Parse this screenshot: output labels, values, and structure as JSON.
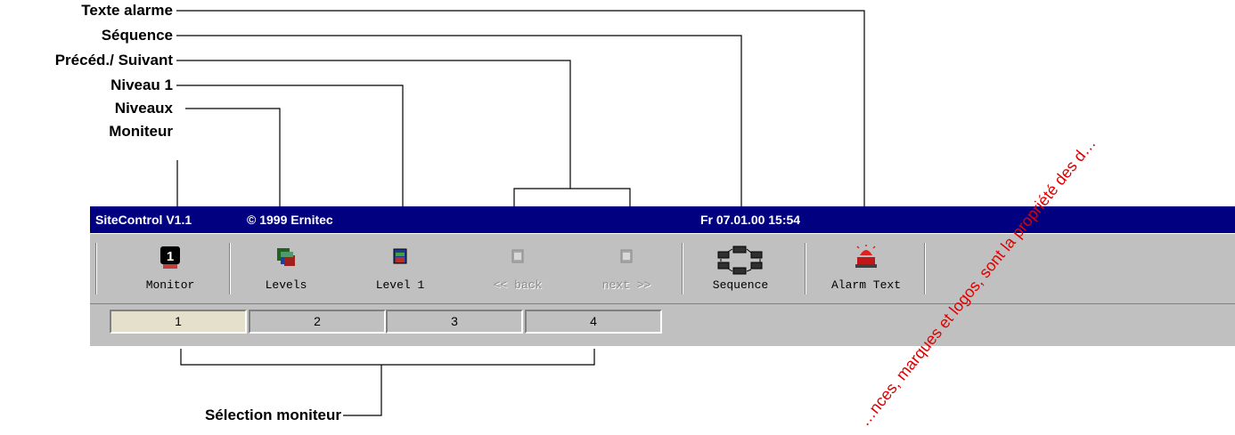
{
  "callouts": {
    "alarm_text": "Texte alarme",
    "sequence": "Séquence",
    "prev_next": "Précéd./ Suivant",
    "level1": "Niveau 1",
    "levels": "Niveaux",
    "monitor": "Moniteur",
    "monitor_select": "Sélection moniteur"
  },
  "titlebar": {
    "app": "SiteControl V1.1",
    "copyright": "© 1999 Ernitec",
    "datetime": "Fr 07.01.00  15:54"
  },
  "toolbar": {
    "monitor": "Monitor",
    "levels": "Levels",
    "level1": "Level 1",
    "back": "<< back",
    "next": "next >>",
    "sequence": "Sequence",
    "alarm_text": "Alarm Text",
    "monitor_number": "1"
  },
  "monitors": [
    "1",
    "2",
    "3",
    "4"
  ],
  "watermark": "…nces, marques et logos, sont la propriété des d…",
  "colors": {
    "titlebar": "#000080",
    "window": "#c0c0c0",
    "watermark": "#e00000"
  }
}
